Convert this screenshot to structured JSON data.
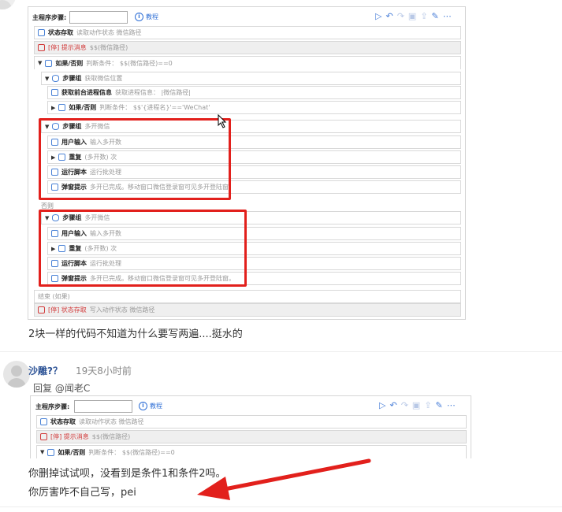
{
  "comment1": {
    "text": "2块一样的代码不知道为什么要写两遍....挺水的"
  },
  "screenshot1": {
    "toolbar": {
      "label": "主程序步骤:",
      "tutorial": "教程"
    },
    "rows": [
      {
        "name": "状态存取",
        "desc": "读取动作状态   微信路径"
      },
      {
        "name": "[停] 提示消息",
        "desc": "$$(微信路径)"
      },
      {
        "name": "如果/否则",
        "desc": "判断条件： $$(微信路径)==0"
      },
      {
        "name": "步骤组",
        "desc": "获取微信位置"
      },
      {
        "name": "获取前台进程信息",
        "desc": "获取进程信息： |微信路径|"
      },
      {
        "name": "如果/否则",
        "desc": "判断条件： $$'{进程名}'=='WeChat'"
      },
      {
        "name": "步骤组",
        "desc": "多开微信"
      },
      {
        "name": "用户输入",
        "desc": "输入多开数"
      },
      {
        "name": "重复",
        "desc": "(多开数) 次"
      },
      {
        "name": "运行脚本",
        "desc": "运行批处理"
      },
      {
        "name": "弹窗提示",
        "desc": "多开已完成。移动窗口微信登录窗可见多开登陆窗。"
      },
      {
        "name": "否则",
        "desc": ""
      },
      {
        "name": "步骤组",
        "desc": "多开微信"
      },
      {
        "name": "用户输入",
        "desc": "输入多开数"
      },
      {
        "name": "重复",
        "desc": "(多开数) 次"
      },
      {
        "name": "运行脚本",
        "desc": "运行批处理"
      },
      {
        "name": "弹窗提示",
        "desc": "多开已完成。移动窗口微信登录窗可见多开登陆窗。"
      },
      {
        "name": "结束 (如果)",
        "desc": ""
      },
      {
        "name": "[停] 状态存取",
        "desc": "写入动作状态   微信路径"
      }
    ]
  },
  "comment2": {
    "username": "沙雕?？",
    "time": "19天8小时前",
    "reply_to": "回复 @闻老C",
    "line1": "你删掉试试呗，没看到是条件1和条件2吗。",
    "line2": "你厉害咋不自己写，pei"
  },
  "screenshot2": {
    "toolbar": {
      "label": "主程序步骤:",
      "tutorial": "教程"
    },
    "rows": [
      {
        "name": "状态存取",
        "desc": "读取动作状态   微信路径"
      },
      {
        "name": "[停] 提示消息",
        "desc": "$$(微信路径)"
      },
      {
        "name": "如果/否则",
        "desc": "判断条件： $$(微信路径)==0"
      }
    ]
  },
  "colors": {
    "highlight": "#e2201c",
    "arrow": "#e2201c",
    "link": "#2f6fd6",
    "username": "#2f5597"
  }
}
